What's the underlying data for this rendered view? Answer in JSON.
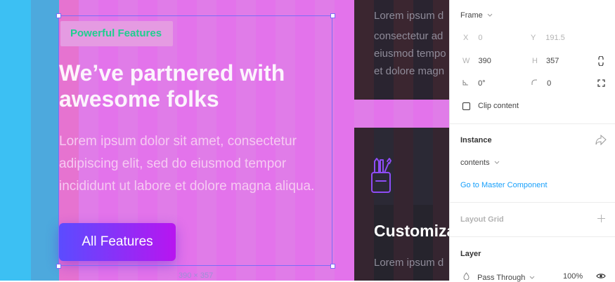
{
  "canvas": {
    "badge": "Powerful Features",
    "headline": "We’ve partnered with awesome folks",
    "body": "Lorem ipsum dolor sit amet, consectetur adipiscing elit, sed do eiusmod tempor incididunt ut labore et dolore magna aliqua.",
    "button": "All Features",
    "selection_dims": "390 × 357",
    "card_top_lines": [
      "Lorem ipsum d",
      "consectetur ad",
      "eiusmod tempo",
      "et dolore magn"
    ],
    "card_bottom_title": "Customiza",
    "card_bottom_line": "Lorem ipsum d"
  },
  "panel": {
    "frame_label": "Frame",
    "x_label": "X",
    "x_value": "0",
    "y_label": "Y",
    "y_value": "191.5",
    "w_label": "W",
    "w_value": "390",
    "h_label": "H",
    "h_value": "357",
    "rotation_value": "0°",
    "radius_value": "0",
    "clip_content": "Clip content",
    "instance_title": "Instance",
    "instance_value": "contents",
    "master_link": "Go to Master Component",
    "layout_grid": "Layout Grid",
    "layer_title": "Layer",
    "blend_mode": "Pass Through",
    "opacity": "100%"
  },
  "colors": {
    "accent": "#18a0fb",
    "badge_text": "#1fcf8f",
    "selection": "#7b6cf6",
    "button_start": "#5b4cff",
    "button_end": "#b815f0"
  }
}
